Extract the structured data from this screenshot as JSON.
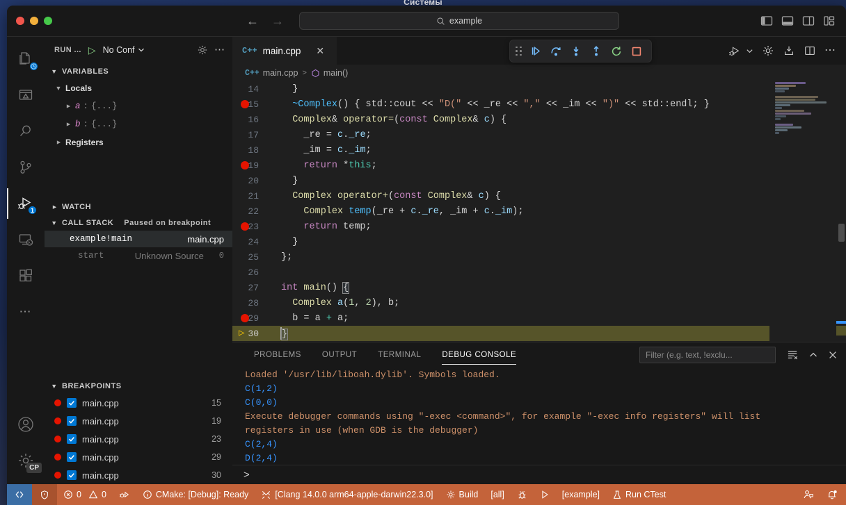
{
  "desktop": {
    "title": "Системы"
  },
  "titlebar": {
    "back_icon": "arrow-left-icon",
    "forward_icon": "arrow-right-icon",
    "search_value": "example",
    "search_icon": "search-icon",
    "layout_icons": [
      "toggle-primary-sidebar-icon",
      "toggle-panel-icon",
      "toggle-secondary-sidebar-icon",
      "customize-layout-icon"
    ]
  },
  "activitybar": {
    "items": [
      {
        "name": "explorer-icon",
        "badge": ""
      },
      {
        "name": "open-preview-icon",
        "badge": ""
      },
      {
        "name": "search-icon",
        "badge": ""
      },
      {
        "name": "source-control-icon",
        "badge": ""
      },
      {
        "name": "run-and-debug-icon",
        "badge": "1"
      },
      {
        "name": "remote-explorer-icon",
        "badge": ""
      },
      {
        "name": "extensions-icon",
        "badge": ""
      },
      {
        "name": "more-views-icon",
        "badge": ""
      }
    ],
    "account_icon": "account-icon",
    "settings_icon": "settings-gear-icon",
    "settings_chip": "CP"
  },
  "sidebar": {
    "title": "RUN ...",
    "run_icon": "start-debugging-icon",
    "configuration": "No Conf",
    "configuration_chevron": "chevron-down-icon",
    "gear_icon": "gear-icon",
    "more_icon": "more-actions-icon",
    "variables": {
      "header": "VARIABLES",
      "scopes": [
        {
          "label": "Locals",
          "expanded": true,
          "items": [
            {
              "name": "a",
              "separator": ":",
              "value": "{...}"
            },
            {
              "name": "b",
              "separator": ":",
              "value": "{...}"
            }
          ]
        },
        {
          "label": "Registers",
          "expanded": false,
          "items": []
        }
      ]
    },
    "watch": {
      "header": "WATCH",
      "expanded": false
    },
    "callstack": {
      "header": "CALL STACK",
      "status": "Paused on breakpoint",
      "frames": [
        {
          "name": "example!main",
          "source": "main.cpp",
          "line": "",
          "selected": true
        },
        {
          "name": "start",
          "source": "Unknown Source",
          "line": "0",
          "selected": false
        }
      ]
    },
    "breakpoints": {
      "header": "BREAKPOINTS",
      "items": [
        {
          "file": "main.cpp",
          "line": "15",
          "checked": true
        },
        {
          "file": "main.cpp",
          "line": "19",
          "checked": true
        },
        {
          "file": "main.cpp",
          "line": "23",
          "checked": true
        },
        {
          "file": "main.cpp",
          "line": "29",
          "checked": true
        },
        {
          "file": "main.cpp",
          "line": "30",
          "checked": true
        }
      ]
    }
  },
  "editor": {
    "tab": {
      "lang_badge": "C++",
      "label": "main.cpp",
      "close_icon": "close-icon"
    },
    "breadcrumb": {
      "lang_badge": "C++",
      "file": "main.cpp",
      "separator": ">",
      "symbol_icon": "symbol-method-icon",
      "symbol": "main()"
    },
    "debug_toolbar": {
      "grip": "drag-handle-icon",
      "buttons": [
        {
          "name": "continue-button",
          "label": "Continue"
        },
        {
          "name": "step-over-button",
          "label": "Step Over"
        },
        {
          "name": "step-into-button",
          "label": "Step Into"
        },
        {
          "name": "step-out-button",
          "label": "Step Out"
        },
        {
          "name": "restart-button",
          "label": "Restart"
        },
        {
          "name": "stop-button",
          "label": "Stop"
        }
      ]
    },
    "actions": [
      "run-or-debug-icon",
      "chevron-down-icon",
      "settings-gear-icon",
      "save-all-icon",
      "split-editor-icon",
      "more-actions-icon"
    ],
    "current_line": 30,
    "lines": [
      {
        "n": 14,
        "bp": false,
        "current": false,
        "indent": 1,
        "text": "}"
      },
      {
        "n": 15,
        "bp": true,
        "current": false,
        "indent": 1,
        "text": "~Complex() { std::cout << \"D(\" << _re << \",\" << _im << \")\" << std::endl; }"
      },
      {
        "n": 16,
        "bp": false,
        "current": false,
        "indent": 1,
        "text": "Complex& operator=(const Complex& c) {"
      },
      {
        "n": 17,
        "bp": false,
        "current": false,
        "indent": 2,
        "text": "_re = c._re;"
      },
      {
        "n": 18,
        "bp": false,
        "current": false,
        "indent": 2,
        "text": "_im = c._im;"
      },
      {
        "n": 19,
        "bp": true,
        "current": false,
        "indent": 2,
        "text": "return *this;"
      },
      {
        "n": 20,
        "bp": false,
        "current": false,
        "indent": 1,
        "text": "}"
      },
      {
        "n": 21,
        "bp": false,
        "current": false,
        "indent": 1,
        "text": "Complex operator+(const Complex& c) {"
      },
      {
        "n": 22,
        "bp": false,
        "current": false,
        "indent": 2,
        "text": "Complex temp(_re + c._re, _im + c._im);"
      },
      {
        "n": 23,
        "bp": true,
        "current": false,
        "indent": 2,
        "text": "return temp;"
      },
      {
        "n": 24,
        "bp": false,
        "current": false,
        "indent": 1,
        "text": "}"
      },
      {
        "n": 25,
        "bp": false,
        "current": false,
        "indent": 0,
        "text": "};"
      },
      {
        "n": 26,
        "bp": false,
        "current": false,
        "indent": 0,
        "text": ""
      },
      {
        "n": 27,
        "bp": false,
        "current": false,
        "indent": 0,
        "text": "int main() {"
      },
      {
        "n": 28,
        "bp": false,
        "current": false,
        "indent": 1,
        "text": "Complex a(1, 2), b;"
      },
      {
        "n": 29,
        "bp": true,
        "current": false,
        "indent": 1,
        "text": "b = a + a;"
      },
      {
        "n": 30,
        "bp": false,
        "current": true,
        "indent": 0,
        "text": "}"
      }
    ]
  },
  "panel": {
    "tabs": [
      {
        "label": "PROBLEMS",
        "active": false
      },
      {
        "label": "OUTPUT",
        "active": false
      },
      {
        "label": "TERMINAL",
        "active": false
      },
      {
        "label": "DEBUG CONSOLE",
        "active": true
      }
    ],
    "filter_placeholder": "Filter (e.g. text, !exclu...",
    "actions": [
      "clear-console-icon",
      "collapse-panel-icon",
      "close-panel-icon"
    ],
    "console_lines": [
      {
        "text": "Loaded '/usr/lib/liboah.dylib'. Symbols loaded.",
        "kind": "output"
      },
      {
        "text": "C(1,2)",
        "kind": "program"
      },
      {
        "text": "C(0,0)",
        "kind": "program"
      },
      {
        "text": "Execute debugger commands using \"-exec <command>\", for example \"-exec info registers\" will list",
        "kind": "output"
      },
      {
        "text": "registers in use (when GDB is the debugger)",
        "kind": "output"
      },
      {
        "text": "C(2,4)",
        "kind": "program"
      },
      {
        "text": "D(2,4)",
        "kind": "program"
      }
    ],
    "repl_prompt": ">"
  },
  "statusbar": {
    "remote_icon": "remote-window-icon",
    "shield_icon": "shield-icon",
    "errors_icon": "error-icon",
    "errors": "0",
    "warnings_icon": "warning-icon",
    "warnings": "0",
    "cmake_target_icon": "cmake-target-icon",
    "cmake_info_icon": "info-icon",
    "cmake_status": "CMake: [Debug]: Ready",
    "kit_icon": "tools-icon",
    "kit": "[Clang 14.0.0 arm64-apple-darwin22.3.0]",
    "build_icon": "gear-icon",
    "build": "Build",
    "build_target": "[all]",
    "debug_icon": "bug-icon",
    "launch_icon": "play-icon",
    "launch_target": "[example]",
    "ctest_icon": "beaker-icon",
    "ctest": "Run CTest",
    "feedback_icon": "feedback-icon",
    "bell_icon": "bell-dot-icon"
  }
}
